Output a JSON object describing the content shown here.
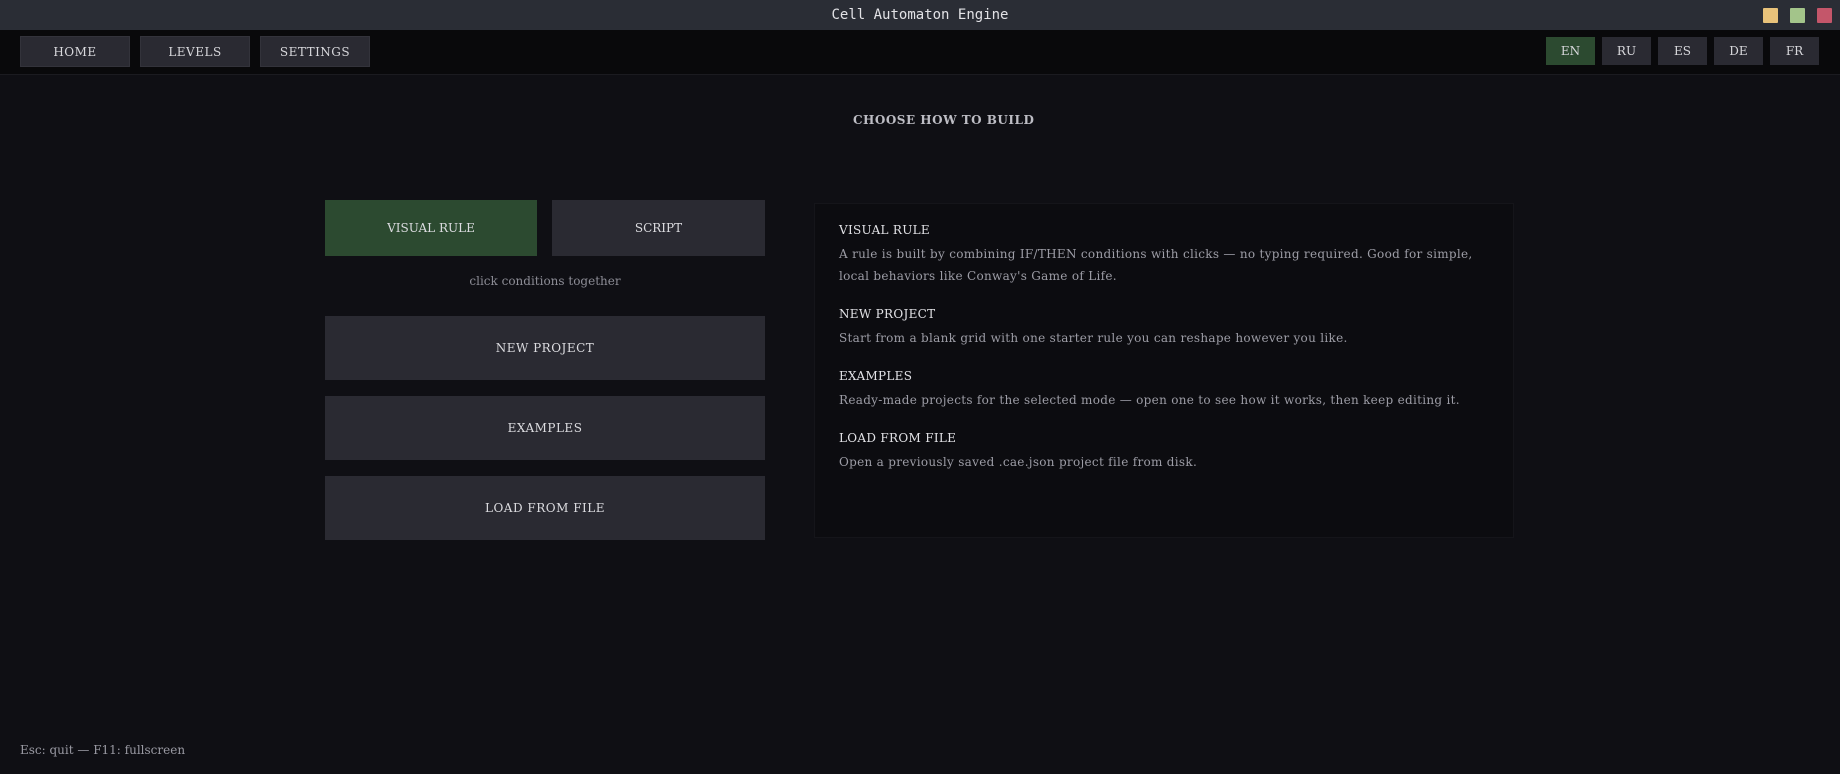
{
  "window": {
    "title": "Cell Automaton Engine",
    "colors": {
      "minimize": "#e8c27a",
      "maximize": "#a3c48a",
      "close": "#c4566a"
    }
  },
  "nav": {
    "items": [
      {
        "label": "HOME"
      },
      {
        "label": "LEVELS"
      },
      {
        "label": "SETTINGS"
      }
    ]
  },
  "languages": {
    "selected": "EN",
    "items": [
      {
        "label": "EN"
      },
      {
        "label": "RU"
      },
      {
        "label": "ES"
      },
      {
        "label": "DE"
      },
      {
        "label": "FR"
      }
    ]
  },
  "heading": "CHOOSE HOW TO BUILD",
  "modes": {
    "selected": "VISUAL RULE",
    "visual_label": "VISUAL RULE",
    "script_label": "SCRIPT",
    "hint": "click conditions together"
  },
  "actions": {
    "new_project": "NEW PROJECT",
    "examples": "EXAMPLES",
    "load_from_file": "LOAD FROM FILE"
  },
  "info": {
    "sections": [
      {
        "title": "VISUAL RULE",
        "text": "A rule is built by combining IF/THEN conditions with clicks — no typing required. Good for simple, local behaviors like Conway's Game of Life."
      },
      {
        "title": "NEW PROJECT",
        "text": "Start from a blank grid with one starter rule you can reshape however you like."
      },
      {
        "title": "EXAMPLES",
        "text": "Ready-made projects for the selected mode — open one to see how it works, then keep editing it."
      },
      {
        "title": "LOAD FROM FILE",
        "text": "Open a previously saved .cae.json project file from disk."
      }
    ]
  },
  "footer": "Esc: quit — F11: fullscreen",
  "accent_color": "#2c4a30"
}
